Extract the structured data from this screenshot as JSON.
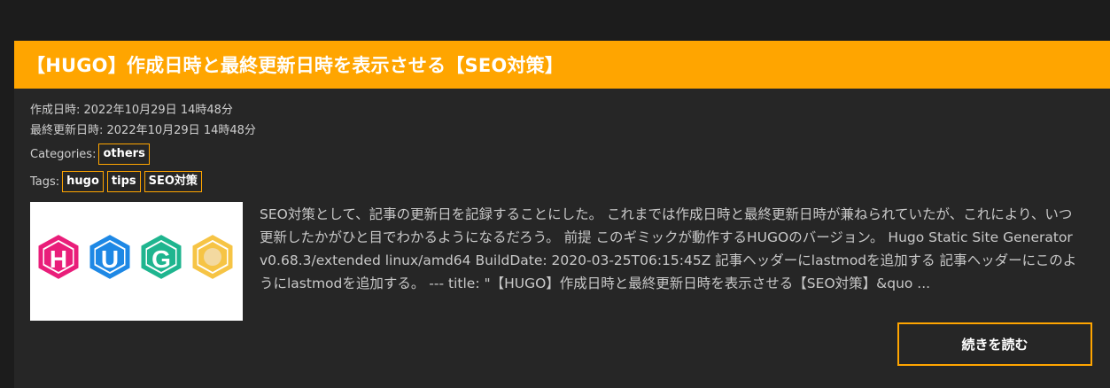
{
  "post": {
    "title": "【HUGO】作成日時と最終更新日時を表示させる【SEO対策】",
    "created": "作成日時: 2022年10月29日 14時48分",
    "updated": "最終更新日時: 2022年10月29日 14時48分",
    "categories_label": "Categories:",
    "categories": [
      "others"
    ],
    "tags_label": "Tags:",
    "tags": [
      "hugo",
      "tips",
      "SEO対策"
    ],
    "thumbnail": {
      "letters": [
        "H",
        "U",
        "G",
        "O"
      ],
      "colors": [
        "#e91e7a",
        "#1e88e5",
        "#1fb58f",
        "#f6c445"
      ]
    },
    "excerpt": "SEO対策として、記事の更新日を記録することにした。 これまでは作成日時と最終更新日時が兼ねられていたが、これにより、いつ更新したかがひと目でわかるようになるだろう。 前提 このギミックが動作するHUGOのバージョン。 Hugo Static Site Generator v0.68.3/extended linux/amd64 BuildDate: 2020-03-25T06:15:45Z 記事ヘッダーにlastmodを追加する 記事ヘッダーにこのようにlastmodを追加する。 --- title: \"【HUGO】作成日時と最終更新日時を表示させる【SEO対策】&quo ...",
    "read_more": "続きを読む"
  },
  "colors": {
    "accent": "#ffa500",
    "background": "#1c1c1c",
    "card": "#262626"
  }
}
